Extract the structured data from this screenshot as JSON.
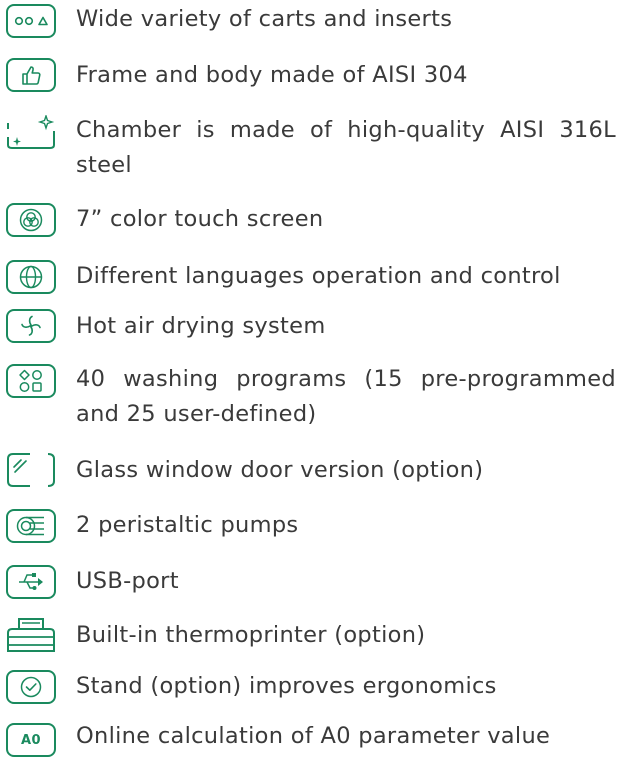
{
  "features": [
    {
      "icon": "carts-icon",
      "text": "Wide variety of carts and inserts"
    },
    {
      "icon": "thumbs-up-icon",
      "text": "Frame and body made of AISI 304"
    },
    {
      "icon": "sparkle-icon",
      "text": "Chamber is made of high-quality AISI 316L steel"
    },
    {
      "icon": "color-circles-icon",
      "text": "7” color touch screen"
    },
    {
      "icon": "globe-icon",
      "text": "Different languages operation and control"
    },
    {
      "icon": "fan-icon",
      "text": "Hot air drying system"
    },
    {
      "icon": "programs-icon",
      "text": "40 washing programs (15 pre-programmed and 25 user-defined)"
    },
    {
      "icon": "glass-window-icon",
      "text": "Glass window door version (option)"
    },
    {
      "icon": "pump-icon",
      "text": "2 peristaltic pumps"
    },
    {
      "icon": "usb-icon",
      "text": "USB-port"
    },
    {
      "icon": "printer-icon",
      "text": "Built-in thermoprinter (option)"
    },
    {
      "icon": "check-circle-icon",
      "text": "Stand (option) improves ergonomics"
    },
    {
      "icon": "a0-icon",
      "icon_text": "A0",
      "text": "Online calculation of A0 parameter value"
    }
  ],
  "colors": {
    "accent": "#1a8a5e",
    "text": "#3a3a3a"
  }
}
